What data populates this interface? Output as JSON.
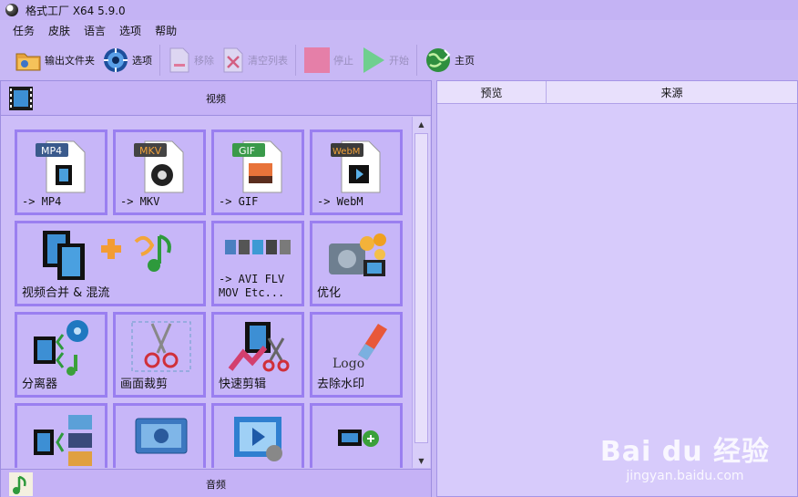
{
  "window": {
    "title": "格式工厂 X64 5.9.0"
  },
  "menu": [
    "任务",
    "皮肤",
    "语言",
    "选项",
    "帮助"
  ],
  "toolbar": {
    "output_folder": "输出文件夹",
    "options": "选项",
    "remove": "移除",
    "clear_list": "清空列表",
    "stop": "停止",
    "start": "开始",
    "home": "主页"
  },
  "panels": {
    "video": "视频",
    "audio": "音频"
  },
  "video_tiles": [
    {
      "label": "-> MP4",
      "badge": "MP4",
      "badge_color": "#3a5a8c"
    },
    {
      "label": "-> MKV",
      "badge": "MKV",
      "badge_color": "#444444"
    },
    {
      "label": "-> GIF",
      "badge": "GIF",
      "badge_color": "#3a9a4a"
    },
    {
      "label": "-> WebM",
      "badge": "WebM",
      "badge_color": "#3b3b3b"
    },
    {
      "label": "视频合并 & 混流"
    },
    {
      "label": "-> AVI FLV\nMOV Etc..."
    },
    {
      "label": "优化"
    },
    {
      "label": "分离器"
    },
    {
      "label": "画面裁剪"
    },
    {
      "label": "快速剪辑"
    },
    {
      "label": "去除水印",
      "art_text": "Logo"
    },
    {
      "label": ""
    },
    {
      "label": ""
    },
    {
      "label": ""
    },
    {
      "label": ""
    }
  ],
  "task_list": {
    "columns": [
      "预览",
      "来源"
    ]
  },
  "watermark": {
    "brand": "Bai du 经验",
    "url": "jingyan.baidu.com"
  }
}
